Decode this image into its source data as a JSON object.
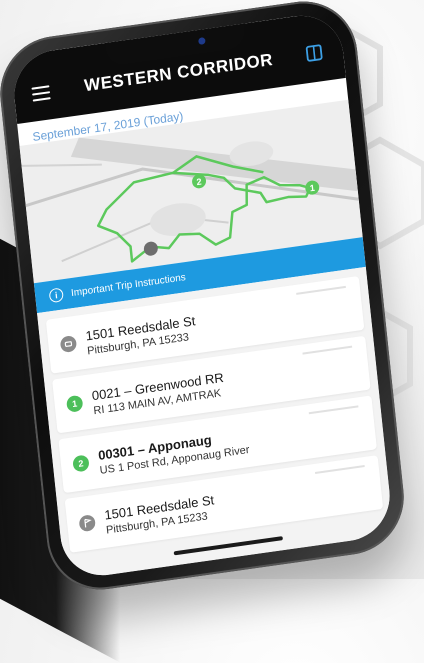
{
  "header": {
    "title": "WESTERN CORRIDOR",
    "menu_icon": "menu-icon",
    "book_icon": "book-icon"
  },
  "date_line": "September 17, 2019 (Today)",
  "map": {
    "markers": [
      "2",
      "1"
    ],
    "route_color": "#5cc95c"
  },
  "instructions": {
    "label": "Important Trip Instructions",
    "icon": "info-icon",
    "color": "#1e9ae0"
  },
  "stops": [
    {
      "marker": "",
      "marker_icon": "start-icon",
      "title": "1501 Reedsdale St",
      "subtitle": "Pittsburgh, PA 15233",
      "bold": false
    },
    {
      "marker": "1",
      "marker_icon": "",
      "title": "0021 – Greenwood RR",
      "subtitle": "RI 113 MAIN AV, AMTRAK",
      "bold": false
    },
    {
      "marker": "2",
      "marker_icon": "",
      "title": "00301 – Apponaug",
      "subtitle": "US 1 Post Rd, Apponaug River",
      "bold": true
    },
    {
      "marker": "",
      "marker_icon": "flag-icon",
      "title": "1501 Reedsdale St",
      "subtitle": "Pittsburgh, PA 15233",
      "bold": false
    }
  ]
}
